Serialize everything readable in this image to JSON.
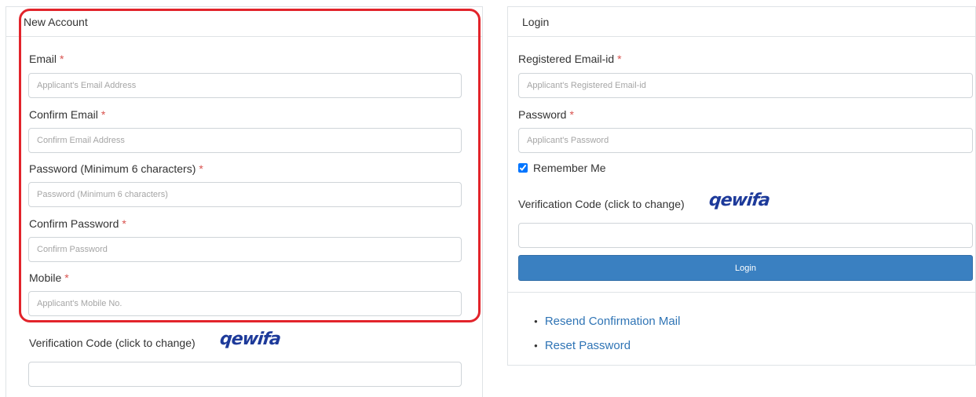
{
  "new_account": {
    "title": "New Account",
    "fields": [
      {
        "label": "Email",
        "required": "*",
        "placeholder": "Applicant's Email Address"
      },
      {
        "label": "Confirm Email",
        "required": "*",
        "placeholder": "Confirm Email Address"
      },
      {
        "label": "Password (Minimum 6 characters)",
        "required": "*",
        "placeholder": "Password (Minimum 6 characters)"
      },
      {
        "label": "Confirm Password",
        "required": "*",
        "placeholder": "Confirm Password"
      },
      {
        "label": "Mobile",
        "required": "*",
        "placeholder": "Applicant's Mobile No."
      }
    ],
    "verification_label": "Verification Code (click to change)",
    "captcha_text": "qewifa",
    "verification_value": ""
  },
  "login": {
    "title": "Login",
    "email_label": "Registered Email-id",
    "email_required": "*",
    "email_placeholder": "Applicant's Registered Email-id",
    "password_label": "Password",
    "password_required": "*",
    "password_placeholder": "Applicant's Password",
    "remember_label": "Remember Me",
    "verification_label": "Verification Code (click to change)",
    "captcha_text": "qewifa",
    "verification_value": "",
    "login_button": "Login",
    "links": [
      "Resend Confirmation Mail",
      "Reset Password"
    ]
  },
  "colors": {
    "required": "#d9534f",
    "primary_button": "#3a80c1",
    "link": "#2f74b5",
    "highlight": "#e2242b",
    "captcha": "#1d3a9a"
  },
  "icons": [
    "checkbox-icon",
    "bullet-icon"
  ]
}
